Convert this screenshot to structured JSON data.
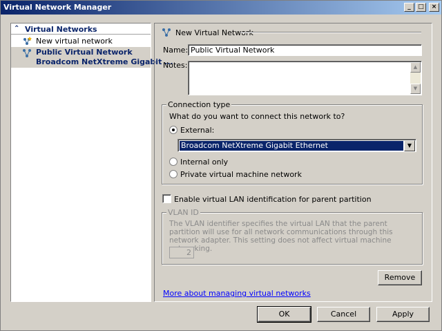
{
  "window": {
    "title": "Virtual Network Manager",
    "controls": {
      "minimize": "_",
      "maximize": "□",
      "close": "×"
    }
  },
  "tree": {
    "header": "Virtual Networks",
    "header_icon": "double-chevron-up-icon",
    "items": [
      {
        "label": "New virtual network",
        "icon": "new-network-icon",
        "selected": false
      },
      {
        "label": "Public Virtual Network",
        "sublabel": "Broadcom NetXtreme Gigabit ...",
        "icon": "network-icon",
        "selected": true
      }
    ]
  },
  "details": {
    "section_title": "New Virtual Network",
    "name_label": "Name:",
    "name_value": "Public Virtual Network",
    "notes_label": "Notes:",
    "notes_value": "",
    "connection": {
      "group_title": "Connection type",
      "question": "What do you want to connect this network to?",
      "options": [
        {
          "label": "External:",
          "checked": true
        },
        {
          "label": "Internal only",
          "checked": false
        },
        {
          "label": "Private virtual machine network",
          "checked": false
        }
      ],
      "adapter_value": "Broadcom NetXtreme Gigabit Ethernet"
    },
    "vlan": {
      "checkbox_label": "Enable virtual LAN identification for parent partition",
      "checked": false,
      "group_title": "VLAN ID",
      "description": "The VLAN identifier specifies the virtual LAN that the parent partition will use for all network communications through this network adapter. This setting does not affect virtual machine networking.",
      "value": "2"
    },
    "remove_button": "Remove",
    "help_link": "More about managing virtual networks"
  },
  "footer": {
    "ok": "OK",
    "cancel": "Cancel",
    "apply": "Apply"
  },
  "colors": {
    "titlebar": "#0a246a",
    "selection": "#0a246a",
    "link": "#0000ff",
    "face": "#d4d0c8"
  }
}
